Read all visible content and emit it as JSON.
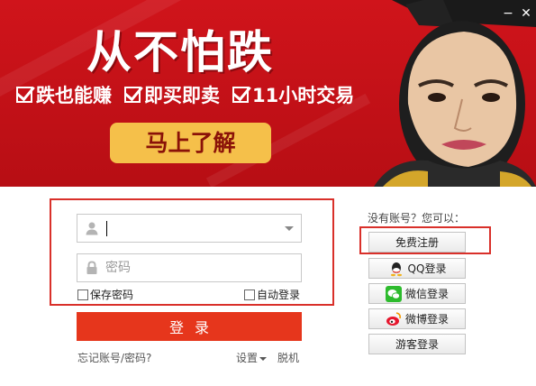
{
  "banner": {
    "headline": "从不怕跌",
    "features": [
      "跌也能赚",
      "即买即卖",
      "11小时交易"
    ],
    "cta_label": "马上了解"
  },
  "window": {
    "minimize": "−",
    "close": "✕"
  },
  "login": {
    "username_value": "",
    "password_placeholder": "密码",
    "remember_label": "保存密码",
    "autologin_label": "自动登录",
    "submit_label": "登录",
    "forgot_label": "忘记账号/密码?",
    "settings_label": "设置",
    "offline_label": "脱机"
  },
  "side": {
    "hint": "没有账号？您可以：",
    "register_label": "免费注册",
    "qq_label": "QQ登录",
    "wechat_label": "微信登录",
    "weibo_label": "微博登录",
    "guest_label": "游客登录"
  },
  "colors": {
    "banner_red": "#c8121a",
    "cta_yellow": "#f5c04a",
    "login_red": "#e6361c",
    "highlight_frame": "#d9302a"
  }
}
